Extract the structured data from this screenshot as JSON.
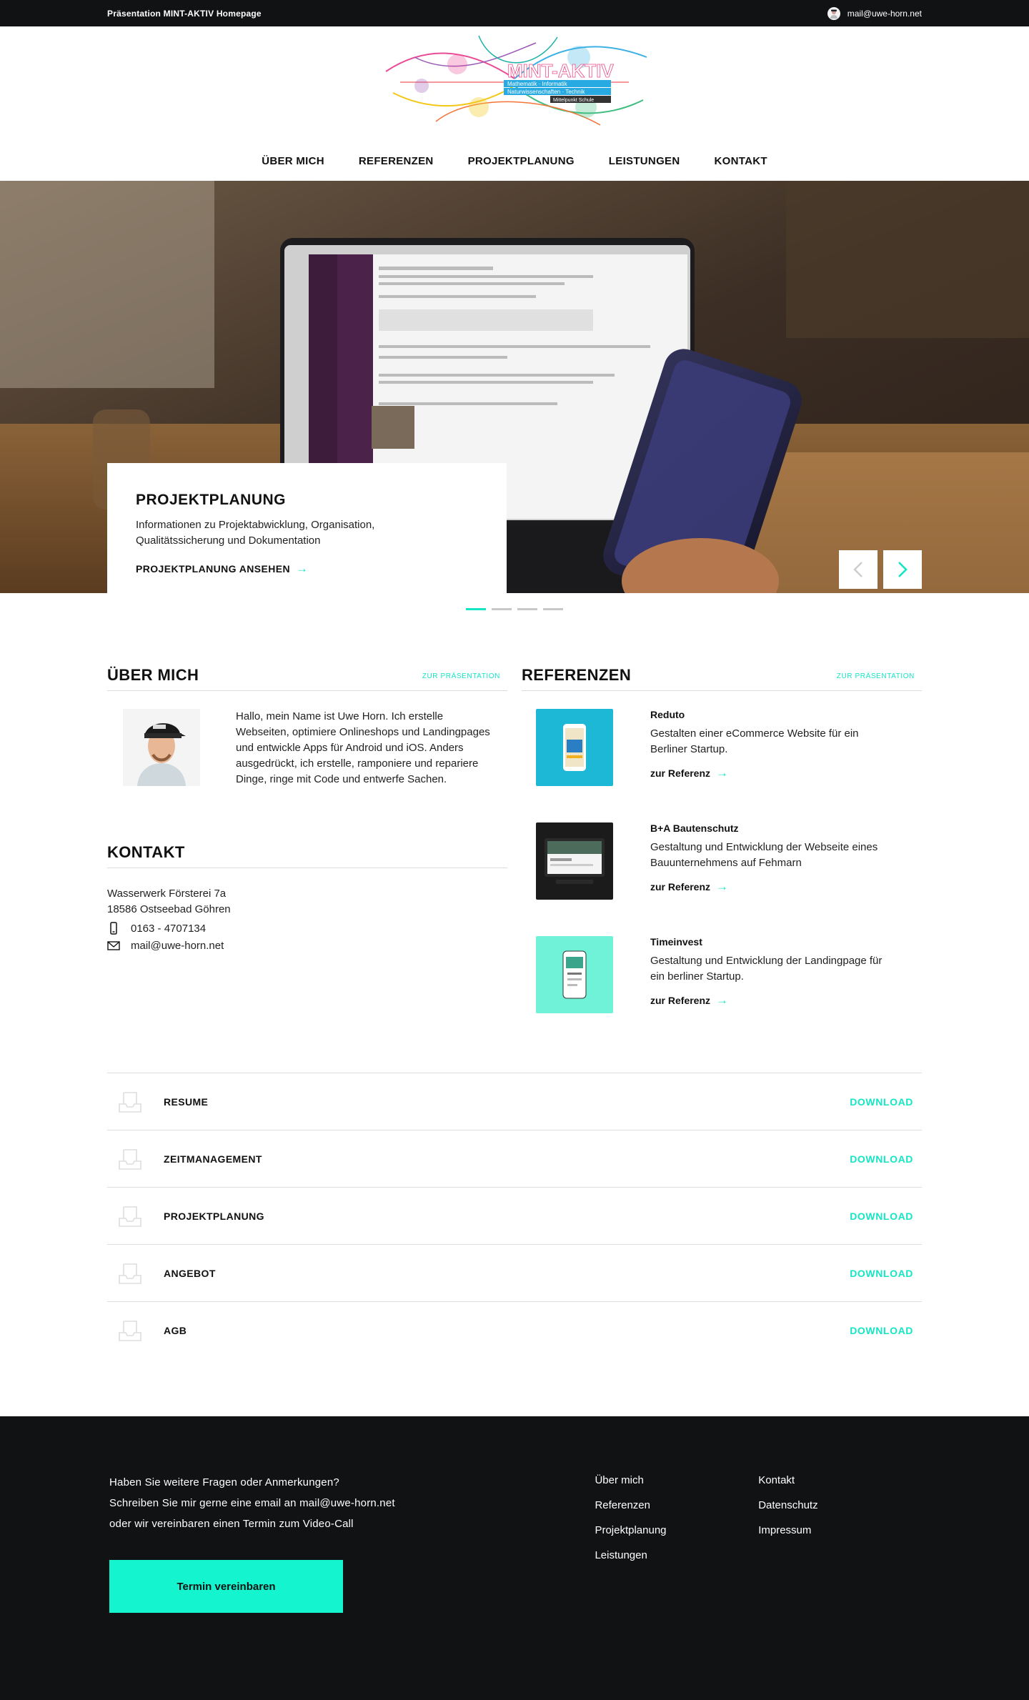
{
  "topbar": {
    "title": "Präsentation MINT-AKTIV Homepage",
    "email": "mail@uwe-horn.net"
  },
  "logo": {
    "title": "MINT-AKTIV",
    "tagline1": "Mathematik · Informatik",
    "tagline2": "Naturwissenschaften · Technik",
    "tagline3": "Mittelpunkt Schule"
  },
  "nav": {
    "items": [
      "ÜBER MICH",
      "REFERENZEN",
      "PROJEKTPLANUNG",
      "LEISTUNGEN",
      "KONTAKT"
    ]
  },
  "hero": {
    "title": "PROJEKTPLANUNG",
    "text": "Informationen zu Projektabwicklung, Organisation, Qualitätssicherung und Dokumentation",
    "link": "PROJEKTPLANUNG ANSEHEN",
    "slides": 4,
    "active_slide": 1
  },
  "about": {
    "heading": "ÜBER MICH",
    "link": "ZUR PRÄSENTATION",
    "text": "Hallo, mein Name ist Uwe Horn. Ich erstelle Webseiten, optimiere Onlineshops und Landingpages und entwickle Apps für Android und iOS. Anders ausgedrückt, ich erstelle, ramponiere und repariere Dinge, ringe mit Code und entwerfe Sachen."
  },
  "contact": {
    "heading": "KONTAKT",
    "street": "Wasserwerk Försterei 7a",
    "city": "18586 Ostseebad Göhren",
    "phone": "0163 - 4707134",
    "email": "mail@uwe-horn.net"
  },
  "references": {
    "heading": "REFERENZEN",
    "link": "ZUR PRÄSENTATION",
    "items": [
      {
        "title": "Reduto",
        "text": "Gestalten einer eCommerce Website für ein Berliner Startup.",
        "link": "zur Referenz",
        "color": "#1cb8d6"
      },
      {
        "title": "B+A Bautenschutz",
        "text": "Gestaltung und Entwicklung der Webseite eines Bauunternehmens auf Fehmarn",
        "link": "zur Referenz",
        "color": "#1b1b1b"
      },
      {
        "title": "Timeinvest",
        "text": "Gestaltung und Entwicklung der Landingpage für ein berliner Startup.",
        "link": "zur Referenz",
        "color": "#6ff2d8"
      }
    ]
  },
  "downloads": {
    "action": "DOWNLOAD",
    "items": [
      "RESUME",
      "ZEITMANAGEMENT",
      "PROJEKTPLANUNG",
      "ANGEBOT",
      "AGB"
    ]
  },
  "footer": {
    "line1": "Haben Sie weitere Fragen oder Anmerkungen?",
    "line2": "Schreiben Sie mir gerne eine email an mail@uwe-horn.net",
    "line3": "oder wir vereinbaren einen Termin zum Video-Call",
    "button": "Termin vereinbaren",
    "col1": [
      "Über mich",
      "Referenzen",
      "Projektplanung",
      "Leistungen"
    ],
    "col2": [
      "Kontakt",
      "Datenschutz",
      "Impressum"
    ]
  },
  "colors": {
    "accent": "#14e6c4",
    "dark": "#111214"
  }
}
